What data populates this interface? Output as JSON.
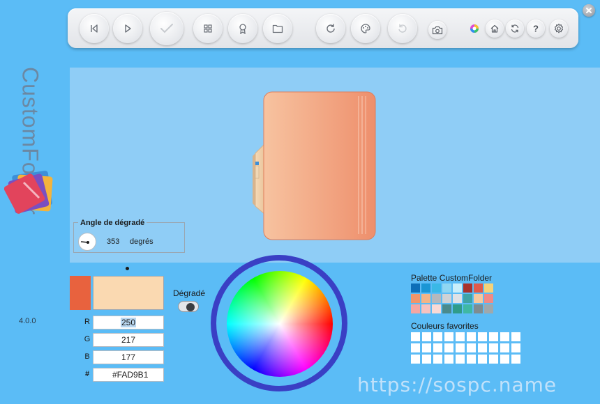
{
  "app": {
    "name": "CustomFolder",
    "version": "4.0.0"
  },
  "toolbar": {
    "buttons": [
      {
        "name": "previous-icon"
      },
      {
        "name": "play-icon"
      },
      {
        "name": "check-icon"
      },
      {
        "name": "grid-icon"
      },
      {
        "name": "badge-icon"
      },
      {
        "name": "folder-icon"
      },
      {
        "name": "refresh-icon"
      },
      {
        "name": "palette-icon"
      },
      {
        "name": "undo-icon"
      },
      {
        "name": "camera-icon"
      },
      {
        "name": "color-wheel-icon"
      },
      {
        "name": "home-icon"
      },
      {
        "name": "sync-icon"
      },
      {
        "name": "help-icon"
      },
      {
        "name": "settings-icon"
      }
    ]
  },
  "gradient_angle": {
    "title": "Angle de dégradé",
    "value": "353",
    "unit": "degrés"
  },
  "color": {
    "current_hex": "#E8623E",
    "new_hex": "#FAD9B1",
    "channels": [
      {
        "label": "R",
        "value": "250"
      },
      {
        "label": "G",
        "value": "217"
      },
      {
        "label": "B",
        "value": "177"
      },
      {
        "label": "#",
        "value": "#FAD9B1"
      }
    ]
  },
  "gradient_toggle": {
    "label": "Dégradé",
    "on": true
  },
  "palette": {
    "title": "Palette CustomFolder",
    "colors": [
      "#0d6fb8",
      "#1a96d4",
      "#3ab8e6",
      "#8fd6f2",
      "#c9eefa",
      "#a8322d",
      "#e05a4a",
      "#f5d27a",
      "#f0956a",
      "#f3b487",
      "#b5b8bd",
      "#cfd2d6",
      "#dfe2e6",
      "#3fa4a6",
      "#f7c89e",
      "#f08a86",
      "#f4a6a2",
      "#f7c2bf",
      "#f9d9d5",
      "#4a8a8c",
      "#2f9c8a",
      "#3fb8a4",
      "#7f8c90",
      "#a0a8ac"
    ]
  },
  "favorites": {
    "title": "Couleurs favorites",
    "count": 30
  },
  "watermark": "https://sospc.name"
}
